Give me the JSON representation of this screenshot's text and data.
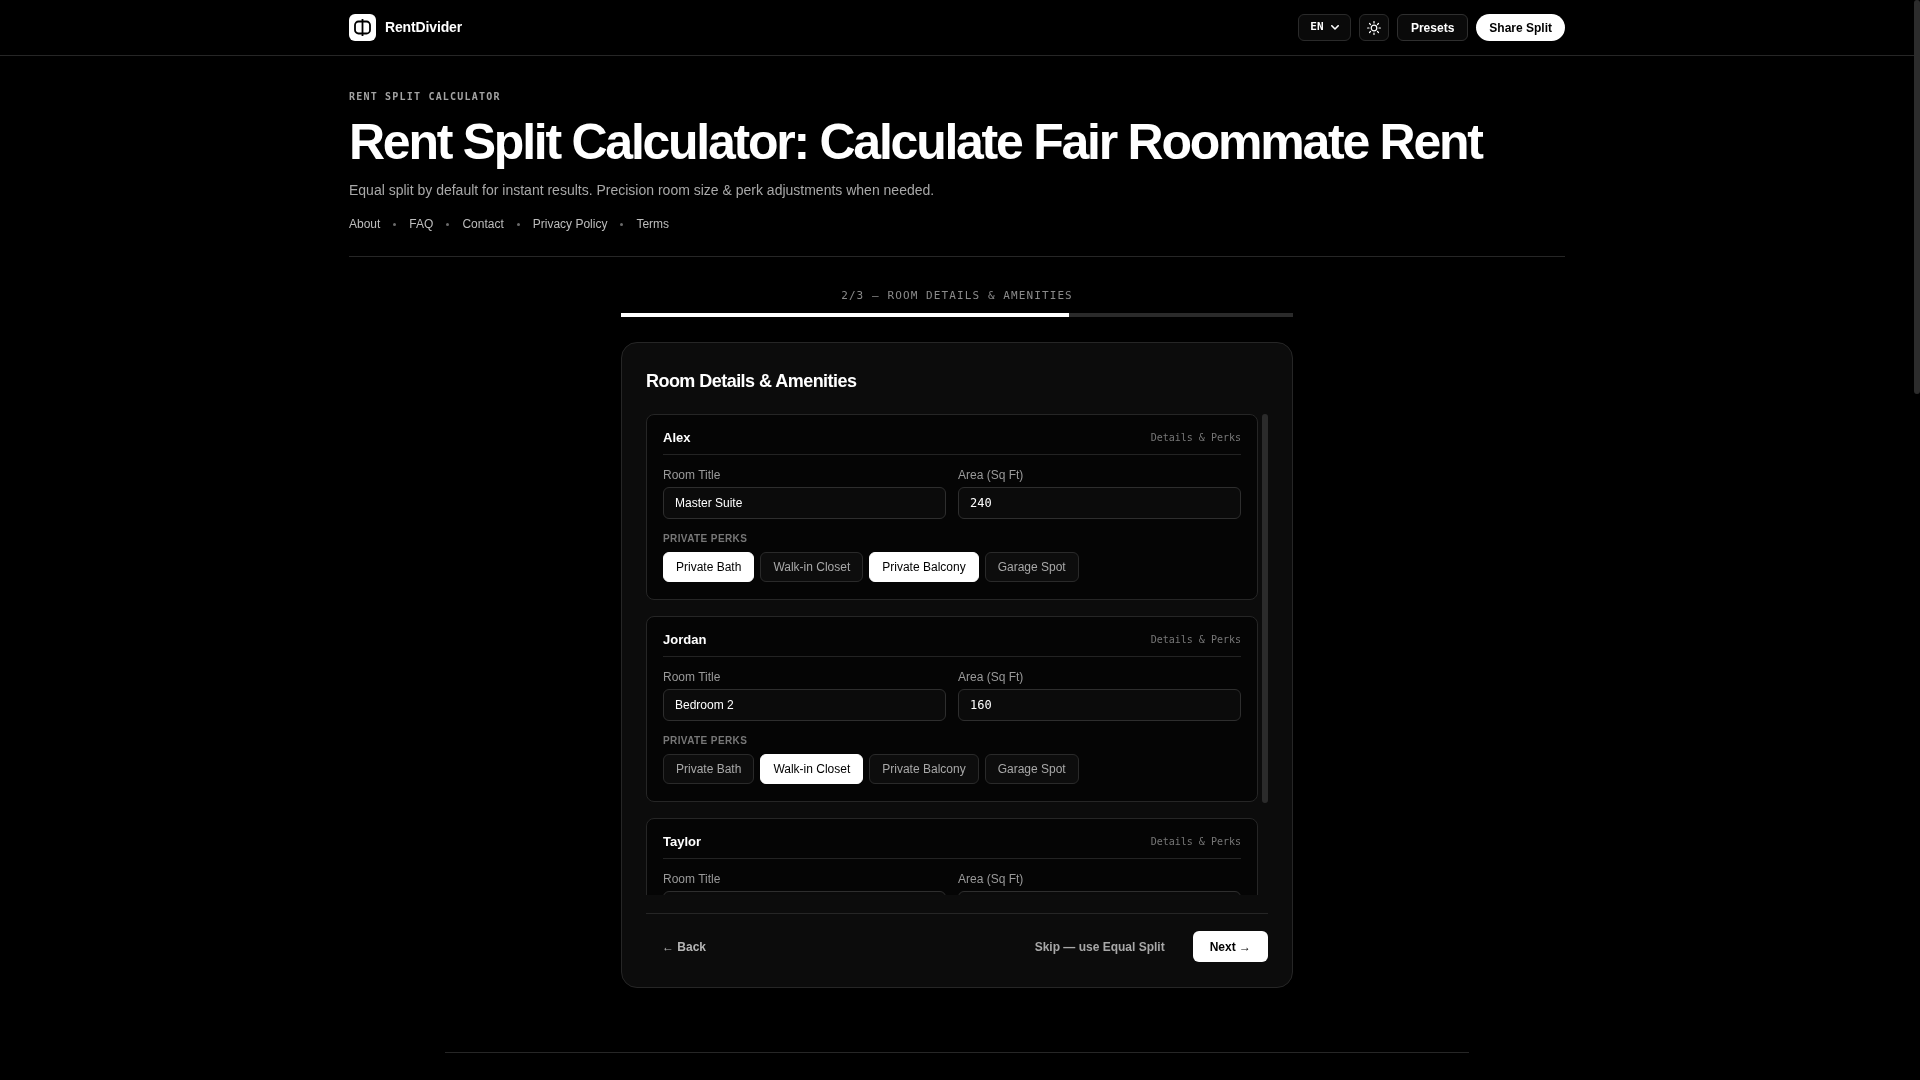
{
  "header": {
    "logo_text": "RentDivider",
    "language": "EN",
    "buttons": [
      {
        "label": "Presets",
        "kind": "outline"
      },
      {
        "label": "Share Split",
        "kind": "primary"
      }
    ]
  },
  "hero": {
    "eyebrow": "RENT SPLIT CALCULATOR",
    "title": "Rent Split Calculator: Calculate Fair Roommate Rent",
    "subtitle": "Equal split by default for instant results. Precision room size & perk adjustments when needed.",
    "links": [
      "About",
      "FAQ",
      "Contact",
      "Privacy Policy",
      "Terms"
    ]
  },
  "progress": {
    "label": "2/3 — ROOM DETAILS & AMENITIES",
    "level": 0.667
  },
  "card": {
    "title": "Room Details & Amenities",
    "rooms": [
      {
        "name": "Alex",
        "tag": "Details & Perks",
        "fields": [
          {
            "label": "Room Title",
            "kind": "text",
            "value": "Master Suite"
          },
          {
            "label": "Area (Sq Ft)",
            "kind": "number",
            "value": "240"
          }
        ],
        "perks_label": "PRIVATE PERKS",
        "perks": [
          {
            "label": "Private Bath",
            "selected": true
          },
          {
            "label": "Walk-in Closet",
            "selected": false
          },
          {
            "label": "Private Balcony",
            "selected": true
          },
          {
            "label": "Garage Spot",
            "selected": false
          }
        ]
      },
      {
        "name": "Jordan",
        "tag": "Details & Perks",
        "fields": [
          {
            "label": "Room Title",
            "kind": "text",
            "value": "Bedroom 2"
          },
          {
            "label": "Area (Sq Ft)",
            "kind": "number",
            "value": "160"
          }
        ],
        "perks_label": "PRIVATE PERKS",
        "perks": [
          {
            "label": "Private Bath",
            "selected": false
          },
          {
            "label": "Walk-in Closet",
            "selected": true
          },
          {
            "label": "Private Balcony",
            "selected": false
          },
          {
            "label": "Garage Spot",
            "selected": false
          }
        ]
      },
      {
        "name": "Taylor",
        "tag": "Details & Perks",
        "fields": [
          {
            "label": "Room Title",
            "kind": "text"
          },
          {
            "label": "Area (Sq Ft)",
            "kind": "number"
          }
        ]
      }
    ]
  },
  "footer": {
    "back": "← Back",
    "skip": "Skip — use Equal Split",
    "next": "Next →"
  }
}
